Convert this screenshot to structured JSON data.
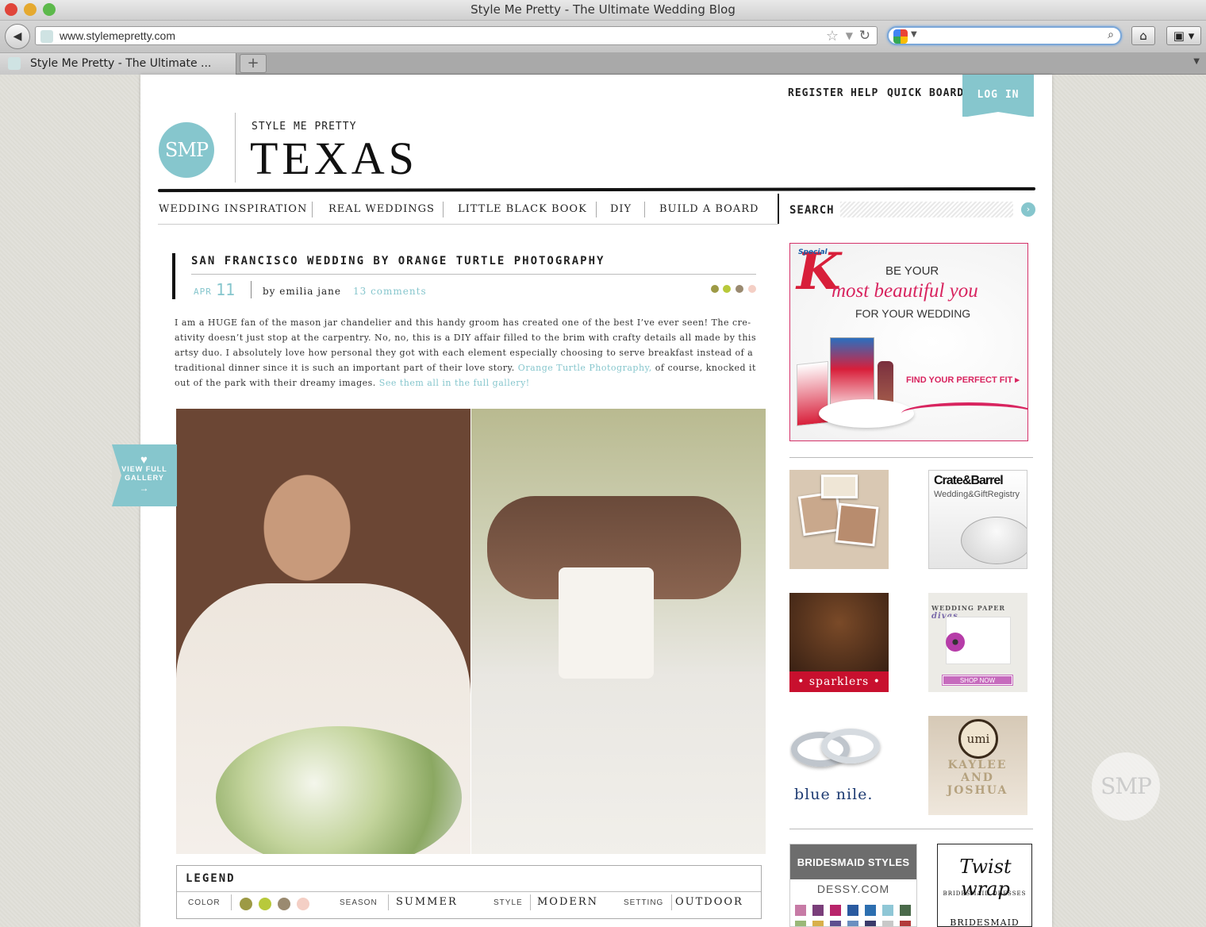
{
  "browser": {
    "window_title": "Style Me Pretty - The Ultimate Wedding Blog",
    "url": "www.stylemepretty.com",
    "tab_title": "Style Me Pretty - The Ultimate ...",
    "new_tab_label": "+",
    "search_value": ""
  },
  "header": {
    "top_links": [
      "REGISTER",
      "HELP",
      "QUICK BOARD"
    ],
    "login_label": "LOG IN",
    "logo_text": "SMP",
    "site_subtitle": "STYLE ME PRETTY",
    "site_title": "TEXAS"
  },
  "nav": {
    "items": [
      "WEDDING INSPIRATION",
      "REAL WEDDINGS",
      "LITTLE BLACK BOOK",
      "DIY",
      "BUILD A BOARD"
    ],
    "search_label": "SEARCH"
  },
  "post": {
    "title": "SAN FRANCISCO WEDDING BY ORANGE TURTLE PHOTOGRAPHY",
    "month": "APR",
    "day": "11",
    "author": "by emilia jane",
    "comments": "13 comments",
    "color_dots": [
      "#9d9a45",
      "#b8c93b",
      "#9a8a70",
      "#f4cfc5"
    ],
    "body_line1": "I am a HUGE fan of the mason jar chandelier and this handy groom has created one of the best I’ve ever seen!  The cre-",
    "body_line2": "ativity doesn’t just stop at the carpentry.  No, no, this is a DIY affair filled to the brim with crafty details all made by this",
    "body_line3": "artsy duo.  I absolutely love how personal they got with each element especially choosing to serve breakfast instead of a",
    "body_line4_a": "traditional dinner since it is such an important part of their love story.",
    "body_link1": "Orange Turtle Photography,",
    "body_line4_b": "of course, knocked it",
    "body_line5": "out of the park with their dreamy images.",
    "body_link2": "See them all in the full gallery!"
  },
  "gallery_tab": {
    "icon": "heart-icon",
    "label_line1": "VIEW FULL",
    "label_line2": "GALLERY",
    "arrow": "→"
  },
  "legend": {
    "title": "LEGEND",
    "color_label": "COLOR",
    "colors": [
      "#9d9a45",
      "#b8c93b",
      "#9a8a70",
      "#f4cfc5"
    ],
    "season_label": "SEASON",
    "season": "SUMMER",
    "style_label": "STYLE",
    "style": "MODERN",
    "setting_label": "SETTING",
    "setting": "OUTDOOR"
  },
  "sidebar": {
    "ad_main": {
      "brand": "Special",
      "letter": "K",
      "line1": "BE YOUR",
      "line2": "most beautiful you",
      "line3": "FOR YOUR WEDDING",
      "cta": "FIND YOUR PERFECT FIT ▸"
    },
    "crate": {
      "name": "Crate&Barrel",
      "sub": "Wedding&GiftRegistry"
    },
    "sparklers": {
      "label": "• sparklers •"
    },
    "paper_divas": {
      "brand_a": "WEDDING",
      "brand_b": "PAPER",
      "brand_c": "divas",
      "shop": "SHOP NOW"
    },
    "bluenile": {
      "label": "blue nile."
    },
    "umi": {
      "seal": "umi",
      "names": "KAYLEE AND JOSHUA"
    },
    "dessy": {
      "heading": "BRIDESMAID STYLES",
      "url": "DESSY.COM",
      "swatches": [
        "#c77ba6",
        "#7a3e7a",
        "#b8246a",
        "#2a5aa0",
        "#2d6fb0",
        "#8fc7d6",
        "#4a6a4a",
        "#9ab878",
        "#d8b04a",
        "#5e4f8f",
        "#6a8fc0",
        "#3a3a6a",
        "#c8c8c8",
        "#b23a3a"
      ]
    },
    "twist": {
      "logo": "Twist wrap",
      "sub": "BRIDESMAID DRESSES",
      "more": "BRIDESMAID"
    }
  },
  "watermark": "SMP"
}
